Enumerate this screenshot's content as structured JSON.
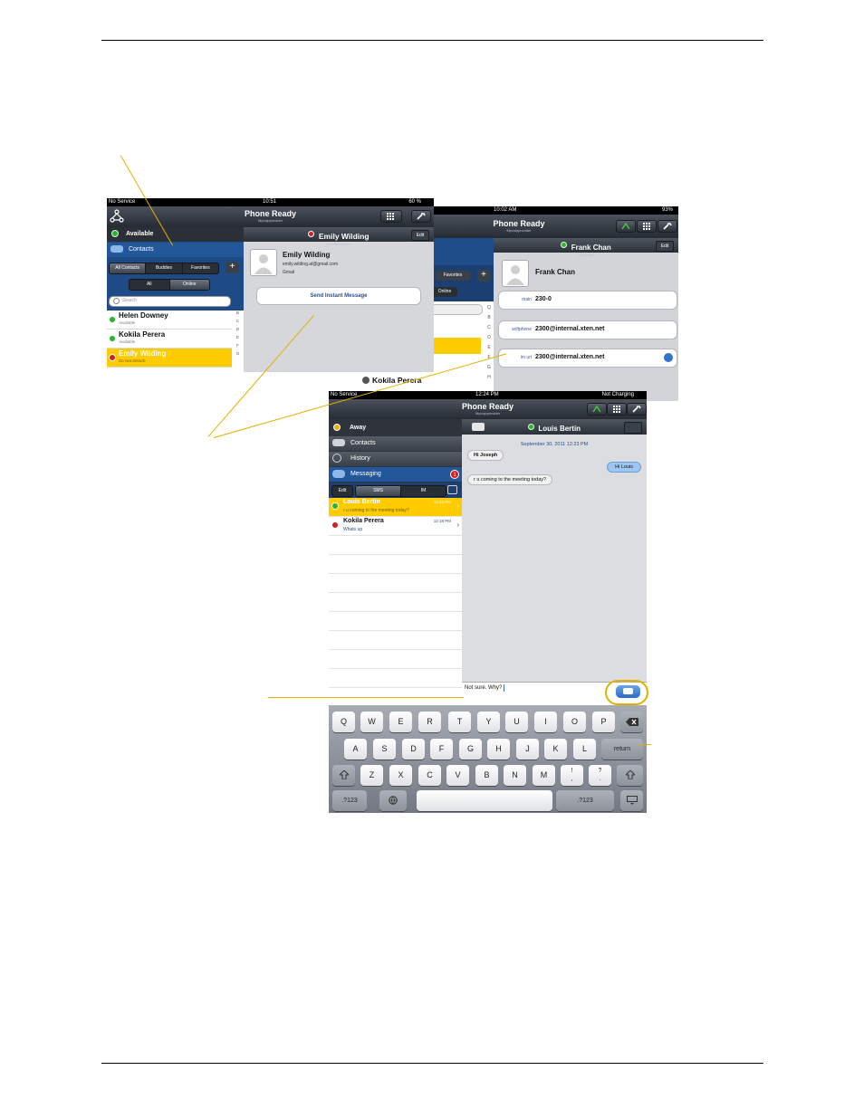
{
  "screen_a": {
    "status": {
      "carrier": "No Service",
      "time": "10:51",
      "battery": "60 %"
    },
    "title": "Phone Ready",
    "subtitle": "Myvoipprovider",
    "presence_label": "Available",
    "nav_contacts": "Contacts",
    "filters": [
      "All Contacts",
      "Buddies",
      "Favorites"
    ],
    "add_symbol": "+",
    "toggle": [
      "All",
      "Online"
    ],
    "search_placeholder": "Search",
    "index_letters": [
      "B",
      "C",
      "D",
      "E",
      "F",
      "G"
    ],
    "contacts": [
      {
        "name": "Helen Downey",
        "status": "Available",
        "presence": "green"
      },
      {
        "name": "Kokila Perera",
        "status": "Available",
        "presence": "green"
      },
      {
        "name": "Emily Wilding",
        "status": "Do Not Disturb",
        "presence": "red"
      }
    ],
    "detail": {
      "header_name": "Emily Wilding",
      "header_status": "Do Not Disturb",
      "edit": "Edit",
      "name": "Emily Wilding",
      "email": "emily.wilding.al@gmail.com",
      "source": "Gmail",
      "send_im": "Send Instant Message"
    }
  },
  "screen_b": {
    "status": {
      "time": "10:02 AM",
      "battery": "93%"
    },
    "title": "Phone Ready",
    "subtitle": "Myvoipprovider",
    "favorites": "Favorites",
    "add_symbol": "+",
    "online": "Online",
    "index_letters": [
      "Q",
      "B",
      "C",
      "D",
      "E",
      "F",
      "G",
      "H"
    ],
    "detail": {
      "header_name": "Frank Chan",
      "header_status": "Available",
      "edit": "Edit",
      "name": "Frank Chan",
      "fields": [
        {
          "label": "main",
          "value": "230-0"
        },
        {
          "label": "softphone",
          "value": "2300@internal.xten.net"
        },
        {
          "label": "im uri",
          "value": "2300@internal.xten.net"
        }
      ]
    },
    "peek_name": "Kokila Perera"
  },
  "screen_c": {
    "status": {
      "carrier": "No Service",
      "time": "12:24 PM",
      "battery": "Not Charging"
    },
    "title": "Phone Ready",
    "subtitle": "Myvoipprovider",
    "presence_label": "Away",
    "nav": [
      "Contacts",
      "History",
      "Messaging"
    ],
    "badge": "1",
    "segments": [
      "Edit",
      "SMS",
      "IM"
    ],
    "conversations": [
      {
        "name": "Louis Bertin",
        "time": "12:23 PM",
        "preview": "r u coming to the meeting today?",
        "presence": "green"
      },
      {
        "name": "Kokila Perera",
        "time": "12:18 PM",
        "preview": "Whats up",
        "presence": "red"
      }
    ],
    "chat": {
      "header_name": "Louis Bertin",
      "date": "September 30, 2011 12:23 PM",
      "messages": [
        {
          "text": "Hi Joseph",
          "side": "left"
        },
        {
          "text": "Hi Louis",
          "side": "right"
        },
        {
          "text": "r u coming to the meeting today?",
          "side": "left"
        }
      ],
      "draft": "Not sure. Why?"
    },
    "keyboard": {
      "row1": [
        "Q",
        "W",
        "E",
        "R",
        "T",
        "Y",
        "U",
        "I",
        "O",
        "P"
      ],
      "row2": [
        "A",
        "S",
        "D",
        "F",
        "G",
        "H",
        "J",
        "K",
        "L"
      ],
      "return": "return",
      "row3": [
        "Z",
        "X",
        "C",
        "V",
        "B",
        "N",
        "M",
        "!\n,",
        "?\n."
      ],
      "numkey": ".?123"
    }
  },
  "colors": {
    "callout": "#e2b100",
    "highlight": "#ffcc00",
    "bubble_blue": "#9cc7f2"
  }
}
